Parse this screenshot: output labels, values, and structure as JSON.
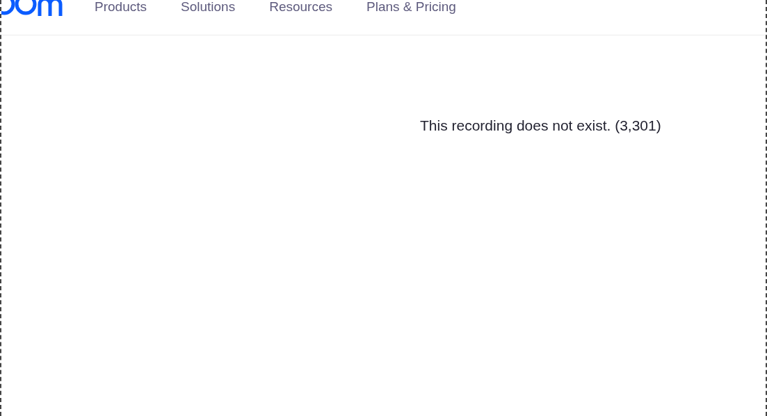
{
  "nav": {
    "items": [
      "Products",
      "Solutions",
      "Resources",
      "Plans & Pricing"
    ]
  },
  "message": "This recording does not exist. (3,301)"
}
